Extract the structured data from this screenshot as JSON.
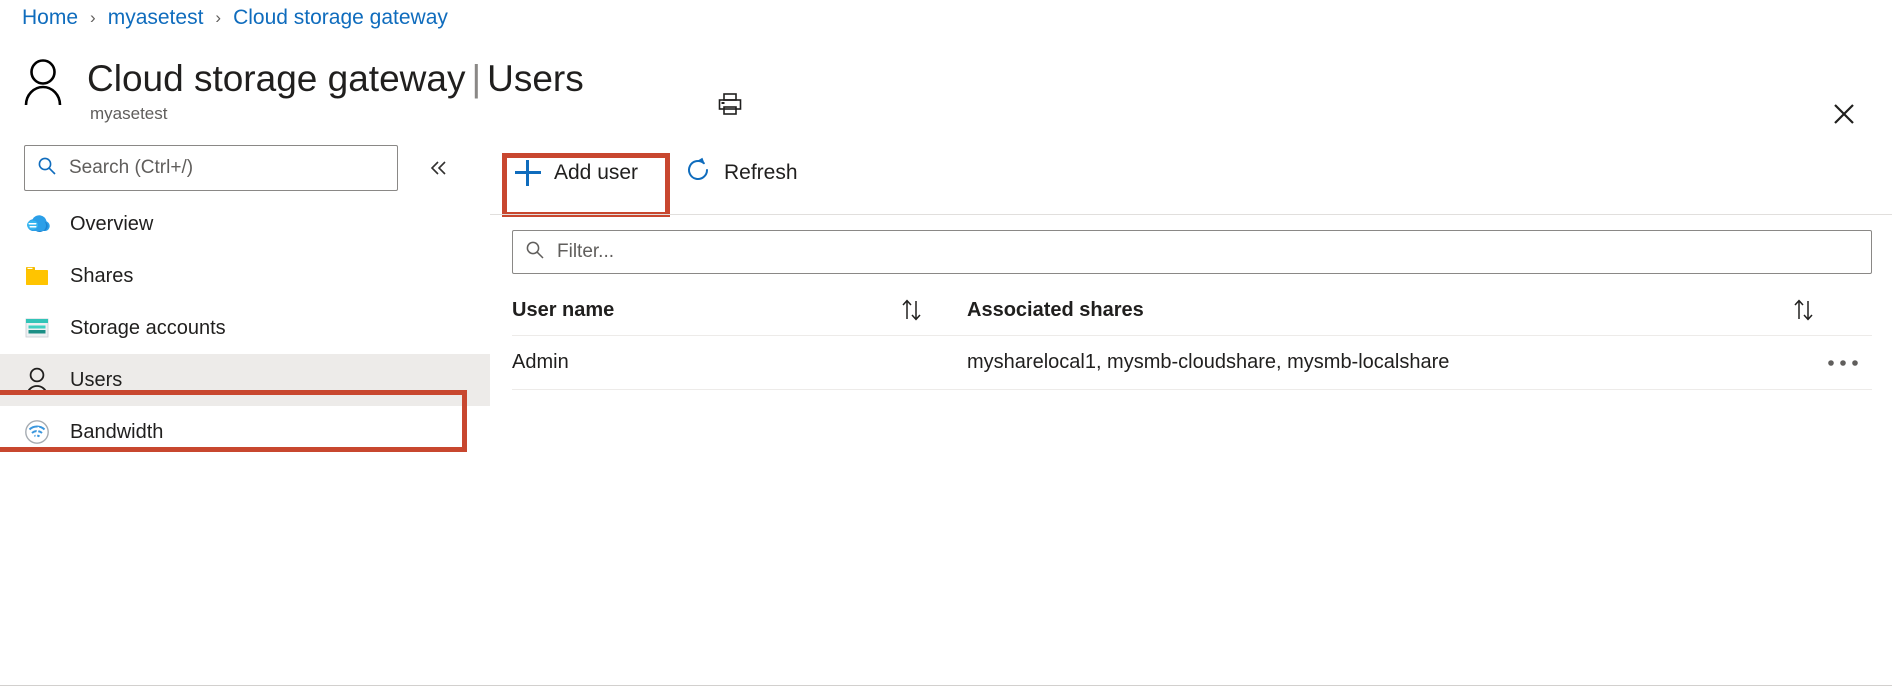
{
  "breadcrumb": {
    "items": [
      {
        "label": "Home"
      },
      {
        "label": "myasetest"
      },
      {
        "label": "Cloud storage gateway"
      }
    ],
    "separator": "›"
  },
  "header": {
    "avatar_icon": "user-avatar-icon",
    "resource_name": "Cloud storage gateway",
    "divider": "|",
    "page_section": "Users",
    "subtitle": "myasetest",
    "print_icon": "print-icon",
    "close_icon": "close-icon"
  },
  "sidebar": {
    "search": {
      "placeholder": "Search (Ctrl+/)",
      "value": "",
      "icon": "search-icon"
    },
    "collapse_icon": "chevron-double-left-icon",
    "items": [
      {
        "label": "Overview",
        "icon": "cloud-icon",
        "selected": false
      },
      {
        "label": "Shares",
        "icon": "folder-icon",
        "selected": false
      },
      {
        "label": "Storage accounts",
        "icon": "storage-account-icon",
        "selected": false
      },
      {
        "label": "Users",
        "icon": "user-icon",
        "selected": true
      },
      {
        "label": "Bandwidth",
        "icon": "wifi-icon",
        "selected": false
      }
    ]
  },
  "toolbar": {
    "add_user_label": "Add user",
    "add_user_icon": "plus-icon",
    "refresh_label": "Refresh",
    "refresh_icon": "refresh-icon"
  },
  "filter": {
    "placeholder": "Filter...",
    "value": "",
    "icon": "search-icon"
  },
  "table": {
    "columns": [
      {
        "label": "User name",
        "sort_icon": "sort-arrows-icon"
      },
      {
        "label": "Associated shares",
        "sort_icon": "sort-arrows-icon"
      }
    ],
    "rows": [
      {
        "user_name": "Admin",
        "associated_shares": "mysharelocal1, mysmb-cloudshare, mysmb-localshare",
        "more_icon": "ellipsis-icon"
      }
    ]
  },
  "highlights": {
    "add_user_box": "red-callout-box",
    "users_nav_box": "red-callout-box",
    "color": "#c8472f"
  },
  "colors": {
    "link": "#0f6cbd",
    "accent": "#0f6cbd",
    "selected_nav_bg": "#edebe9",
    "callout_red": "#c8472f"
  }
}
